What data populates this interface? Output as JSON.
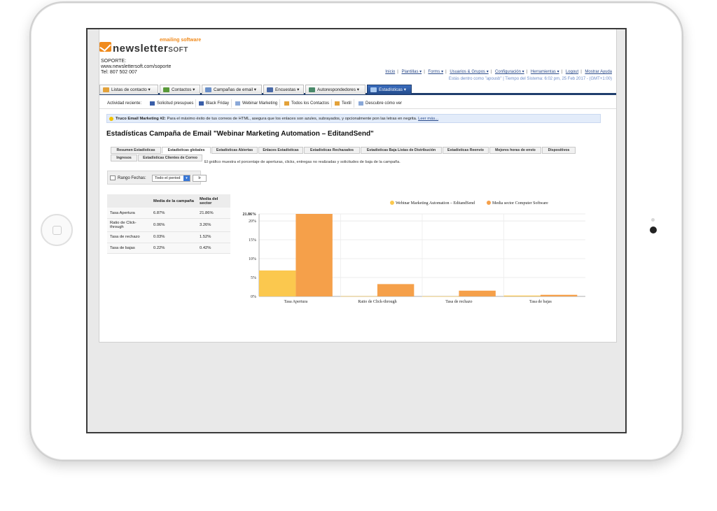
{
  "logo": {
    "tagline": "emailing software",
    "word": "newsletter",
    "word_soft": "SOFT"
  },
  "support": {
    "line1": "SOPORTE:",
    "line2": "www.newslettersoft.com/soporte",
    "line3": "Tel: 807 502 007"
  },
  "toplinks": [
    "Inicio",
    "Plantillas ▾",
    "Forms ▾",
    "Usuarios & Grupos ▾",
    "Configuración ▾",
    "Herramientas ▾",
    "Logout",
    "Mostrar Ayuda"
  ],
  "sysinfo": "Estás dentro como \"apousb\" | Tiempo del Sistema: 6:02 pm, 25 Feb 2017 - (GMT+1:00)",
  "tabs": [
    {
      "label": "Listas de contacto ▾",
      "color": "#e3a23a"
    },
    {
      "label": "Contactos ▾",
      "color": "#5a9a3a"
    },
    {
      "label": "Campañas de email ▾",
      "color": "#6a8fc8"
    },
    {
      "label": "Encuestas ▾",
      "color": "#4a6aa8"
    },
    {
      "label": "Autorespondedores ▾",
      "color": "#4a8a6a"
    },
    {
      "label": "Estadísticas ▾",
      "color": "#a8c8f0"
    }
  ],
  "recent": {
    "label": "Actividad reciente:",
    "items": [
      "Solicitud presupues",
      "Black Friday",
      "Webinar Marketing",
      "Todos los Contactos",
      "Textil",
      "Descubre cómo ver"
    ]
  },
  "tip": {
    "bold": "Truco Email Marketing #2:",
    "text": " Para el máximo éxito de tus correos de HTML, asegura que los enlaces son azules, subrayados, y opcionalmente pon las letras en negrita. ",
    "link": "Leer más..."
  },
  "title": "Estadísticas Campaña de Email \"Webinar Marketing Automation – EditandSend\"",
  "subtabs_row1": [
    "Resumen Estadísticas",
    "Estadísticas globales",
    "Estadísticas Abiertas",
    "Enlaces Estadísticas",
    "Estadísticas Rechazados",
    "Estadísticas Baja Listas de Distribución",
    "Estadísticas Reenvío",
    "Mejores horas de envío",
    "Dispositivos"
  ],
  "subtabs_row2": [
    "Ingresos",
    "Estadísticas Clientes de Correo"
  ],
  "description": "El gráfico muestra el porcentaje de aperturas, clicks, entregas no realizadas y solicitudes de baja de la campaña.",
  "range": {
    "label": "Rango Fechas:",
    "selected": "Todo el period",
    "button": "Ir"
  },
  "table": {
    "headers": [
      "",
      "Media de la campaña",
      "Media del sector"
    ],
    "rows": [
      [
        "Tasa Apertura",
        "6.87%",
        "21.86%"
      ],
      [
        "Ratio de Click-through",
        "0.06%",
        "3.26%"
      ],
      [
        "Tasa de rechazo",
        "0.03%",
        "1.52%"
      ],
      [
        "Tasa de bajas",
        "0.22%",
        "0.42%"
      ]
    ]
  },
  "chart_data": {
    "type": "bar",
    "categories": [
      "Tasa Apertura",
      "Ratio de Click-through",
      "Tasa de rechazo",
      "Tasa de bajas"
    ],
    "series": [
      {
        "name": "Webinar Marketing Automation – EditandSend",
        "values": [
          6.87,
          0.06,
          0.03,
          0.22
        ],
        "color": "#fbc84e"
      },
      {
        "name": "Media sector Computer Software",
        "values": [
          21.86,
          3.26,
          1.52,
          0.42
        ],
        "color": "#f5a04a"
      }
    ],
    "yticks": [
      "0%",
      "5%",
      "10%",
      "15%",
      "20%"
    ],
    "ymax_label": "21.86%",
    "ylim": [
      0,
      21.86
    ],
    "legend": "top-right",
    "grid": true
  }
}
